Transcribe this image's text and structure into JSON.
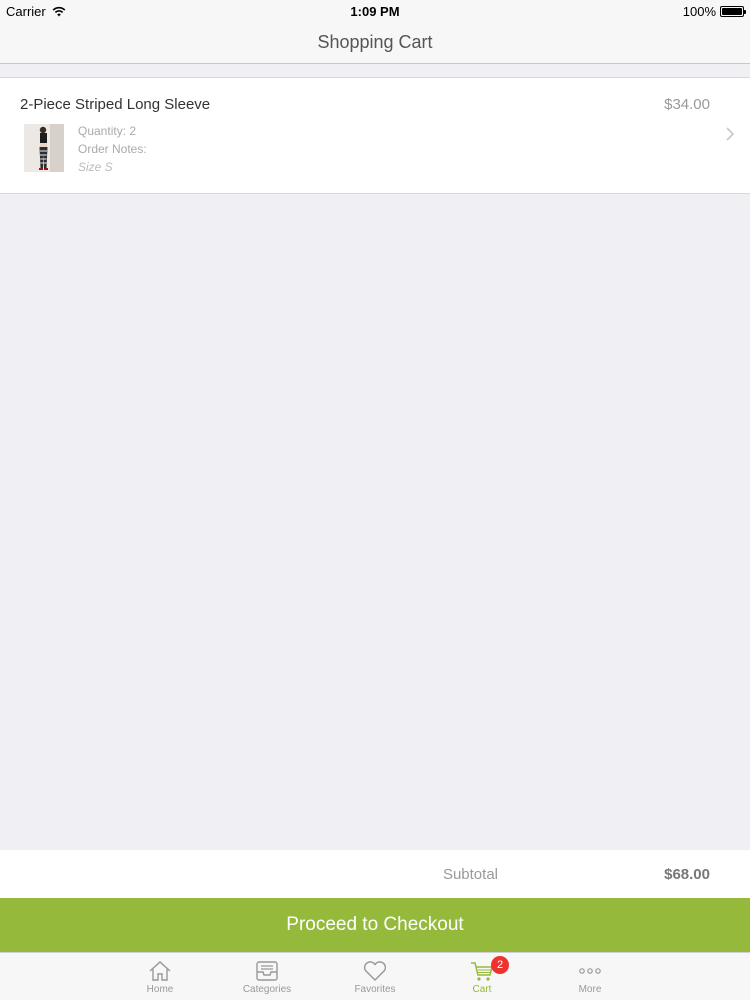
{
  "status_bar": {
    "carrier": "Carrier",
    "time": "1:09 PM",
    "battery": "100%"
  },
  "nav": {
    "title": "Shopping Cart"
  },
  "cart": {
    "items": [
      {
        "title": "2-Piece Striped Long Sleeve",
        "price": "$34.00",
        "quantity": "Quantity: 2",
        "notes_label": "Order Notes:",
        "notes_value": "Size S"
      }
    ]
  },
  "summary": {
    "subtotal_label": "Subtotal",
    "subtotal_value": "$68.00"
  },
  "checkout": {
    "label": "Proceed to Checkout"
  },
  "tab_bar": {
    "tabs": [
      {
        "label": "Home",
        "icon": "home-icon"
      },
      {
        "label": "Categories",
        "icon": "inbox-icon"
      },
      {
        "label": "Favorites",
        "icon": "heart-icon"
      },
      {
        "label": "Cart",
        "icon": "cart-icon",
        "badge": "2",
        "active": true
      },
      {
        "label": "More",
        "icon": "more-icon"
      }
    ]
  },
  "colors": {
    "accent": "#95b93b",
    "badge": "#f0322e",
    "background": "#efeff4"
  }
}
